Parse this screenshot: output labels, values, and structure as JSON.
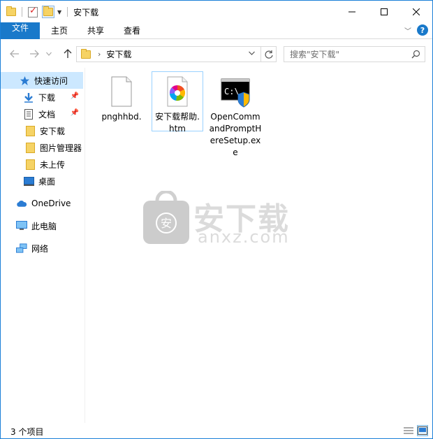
{
  "window": {
    "title": "安下载",
    "controls": [
      "minimize",
      "maximize",
      "close"
    ]
  },
  "ribbon": {
    "tabs": [
      {
        "label": "文件",
        "active": true
      },
      {
        "label": "主页"
      },
      {
        "label": "共享"
      },
      {
        "label": "查看"
      }
    ]
  },
  "address": {
    "crumbs": [
      "安下载"
    ],
    "search_placeholder": "搜索\"安下载\""
  },
  "navpane": {
    "items": [
      {
        "label": "快速访问",
        "icon": "star-icon",
        "selected": true
      },
      {
        "label": "下载",
        "icon": "download-icon",
        "pinned": true
      },
      {
        "label": "文档",
        "icon": "document-icon",
        "pinned": true
      },
      {
        "label": "安下载",
        "icon": "folder-icon"
      },
      {
        "label": "图片管理器",
        "icon": "folder-icon"
      },
      {
        "label": "未上传",
        "icon": "folder-icon"
      },
      {
        "label": "桌面",
        "icon": "desktop-icon"
      },
      {
        "label": "OneDrive",
        "icon": "cloud-icon"
      },
      {
        "label": "此电脑",
        "icon": "computer-icon"
      },
      {
        "label": "网络",
        "icon": "network-icon"
      }
    ]
  },
  "files": [
    {
      "name": "pnghhbd.",
      "icon": "blank-file-icon"
    },
    {
      "name": "安下载帮助.htm",
      "icon": "browser-file-icon",
      "selected": true
    },
    {
      "name": "OpenCommandPromptHereSetup.exe",
      "icon": "cmd-installer-icon"
    }
  ],
  "watermark": {
    "text": "安下载",
    "subtext": "anxz.com",
    "badge": "安"
  },
  "status": {
    "count_text": "3 个项目"
  },
  "colors": {
    "accent": "#1979ca",
    "selection": "#cce8ff",
    "folder": "#f6d365"
  }
}
